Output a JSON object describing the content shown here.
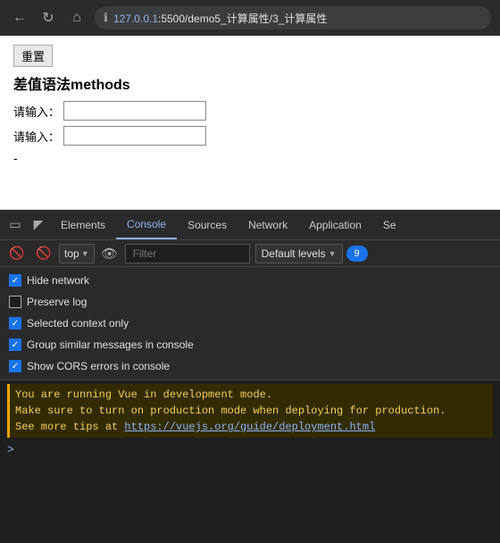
{
  "browser": {
    "url_host": "127.0.0.1",
    "url_port": ":5500",
    "url_path": "/demo5_计算属性/3_计算属性",
    "info_icon": "ℹ"
  },
  "page": {
    "reset_button": "重置",
    "title": "差值语法methods",
    "label1": "请输入：",
    "label2": "请输入：",
    "minus": "-"
  },
  "devtools": {
    "tabs": [
      {
        "label": "Elements",
        "active": false
      },
      {
        "label": "Console",
        "active": true
      },
      {
        "label": "Sources",
        "active": false
      },
      {
        "label": "Network",
        "active": false
      },
      {
        "label": "Application",
        "active": false
      },
      {
        "label": "Se",
        "active": false
      }
    ],
    "toolbar": {
      "top_label": "top",
      "filter_placeholder": "Filter",
      "levels_label": "Default levels",
      "badge_count": "9"
    },
    "options": [
      {
        "label": "Hide network",
        "checked": true
      },
      {
        "label": "Preserve log",
        "checked": false
      },
      {
        "label": "Selected context only",
        "checked": true
      },
      {
        "label": "Group similar messages in console",
        "checked": true
      },
      {
        "label": "Show CORS errors in console",
        "checked": true
      }
    ],
    "console_output": {
      "line1": "You are running Vue in development mode.",
      "line2": "Make sure to turn on production mode when deploying for production.",
      "line3_prefix": "See more tips at ",
      "line3_link": "https://vuejs.org/guide/deployment.html"
    }
  }
}
